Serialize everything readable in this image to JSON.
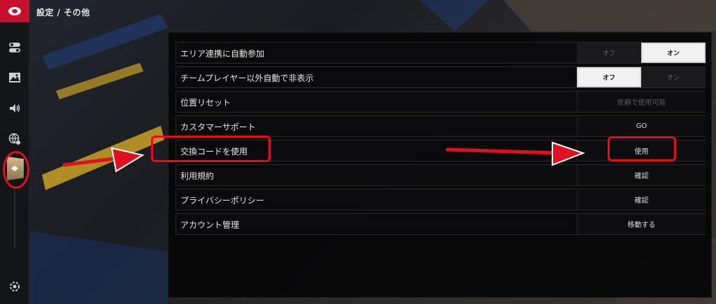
{
  "breadcrumb": "設定 / その他",
  "sidebar": {
    "icons": [
      "toggle-icon",
      "image-icon",
      "sound-icon",
      "globe-icon",
      "other-settings-icon",
      "gear-icon"
    ]
  },
  "settings": {
    "rows": [
      {
        "label": "エリア連携に自動参加",
        "type": "toggle",
        "off": "オフ",
        "on": "オン",
        "selected": "on"
      },
      {
        "label": "チームプレイヤー以外自動で非表示",
        "type": "toggle",
        "off": "オフ",
        "on": "オン",
        "selected": "off"
      },
      {
        "label": "位置リセット",
        "type": "button",
        "action": "依頼で使用可能",
        "disabled": true
      },
      {
        "label": "カスタマーサポート",
        "type": "button",
        "action": "GO"
      },
      {
        "label": "交換コードを使用",
        "type": "button",
        "action": "使用"
      },
      {
        "label": "利用規約",
        "type": "button",
        "action": "確認"
      },
      {
        "label": "プライバシーポリシー",
        "type": "button",
        "action": "確認"
      },
      {
        "label": "アカウント管理",
        "type": "button",
        "action": "移動する"
      }
    ]
  },
  "colors": {
    "annotation": "#e01020",
    "accent": "#c8102e",
    "active_tab": "#d4b98a"
  }
}
